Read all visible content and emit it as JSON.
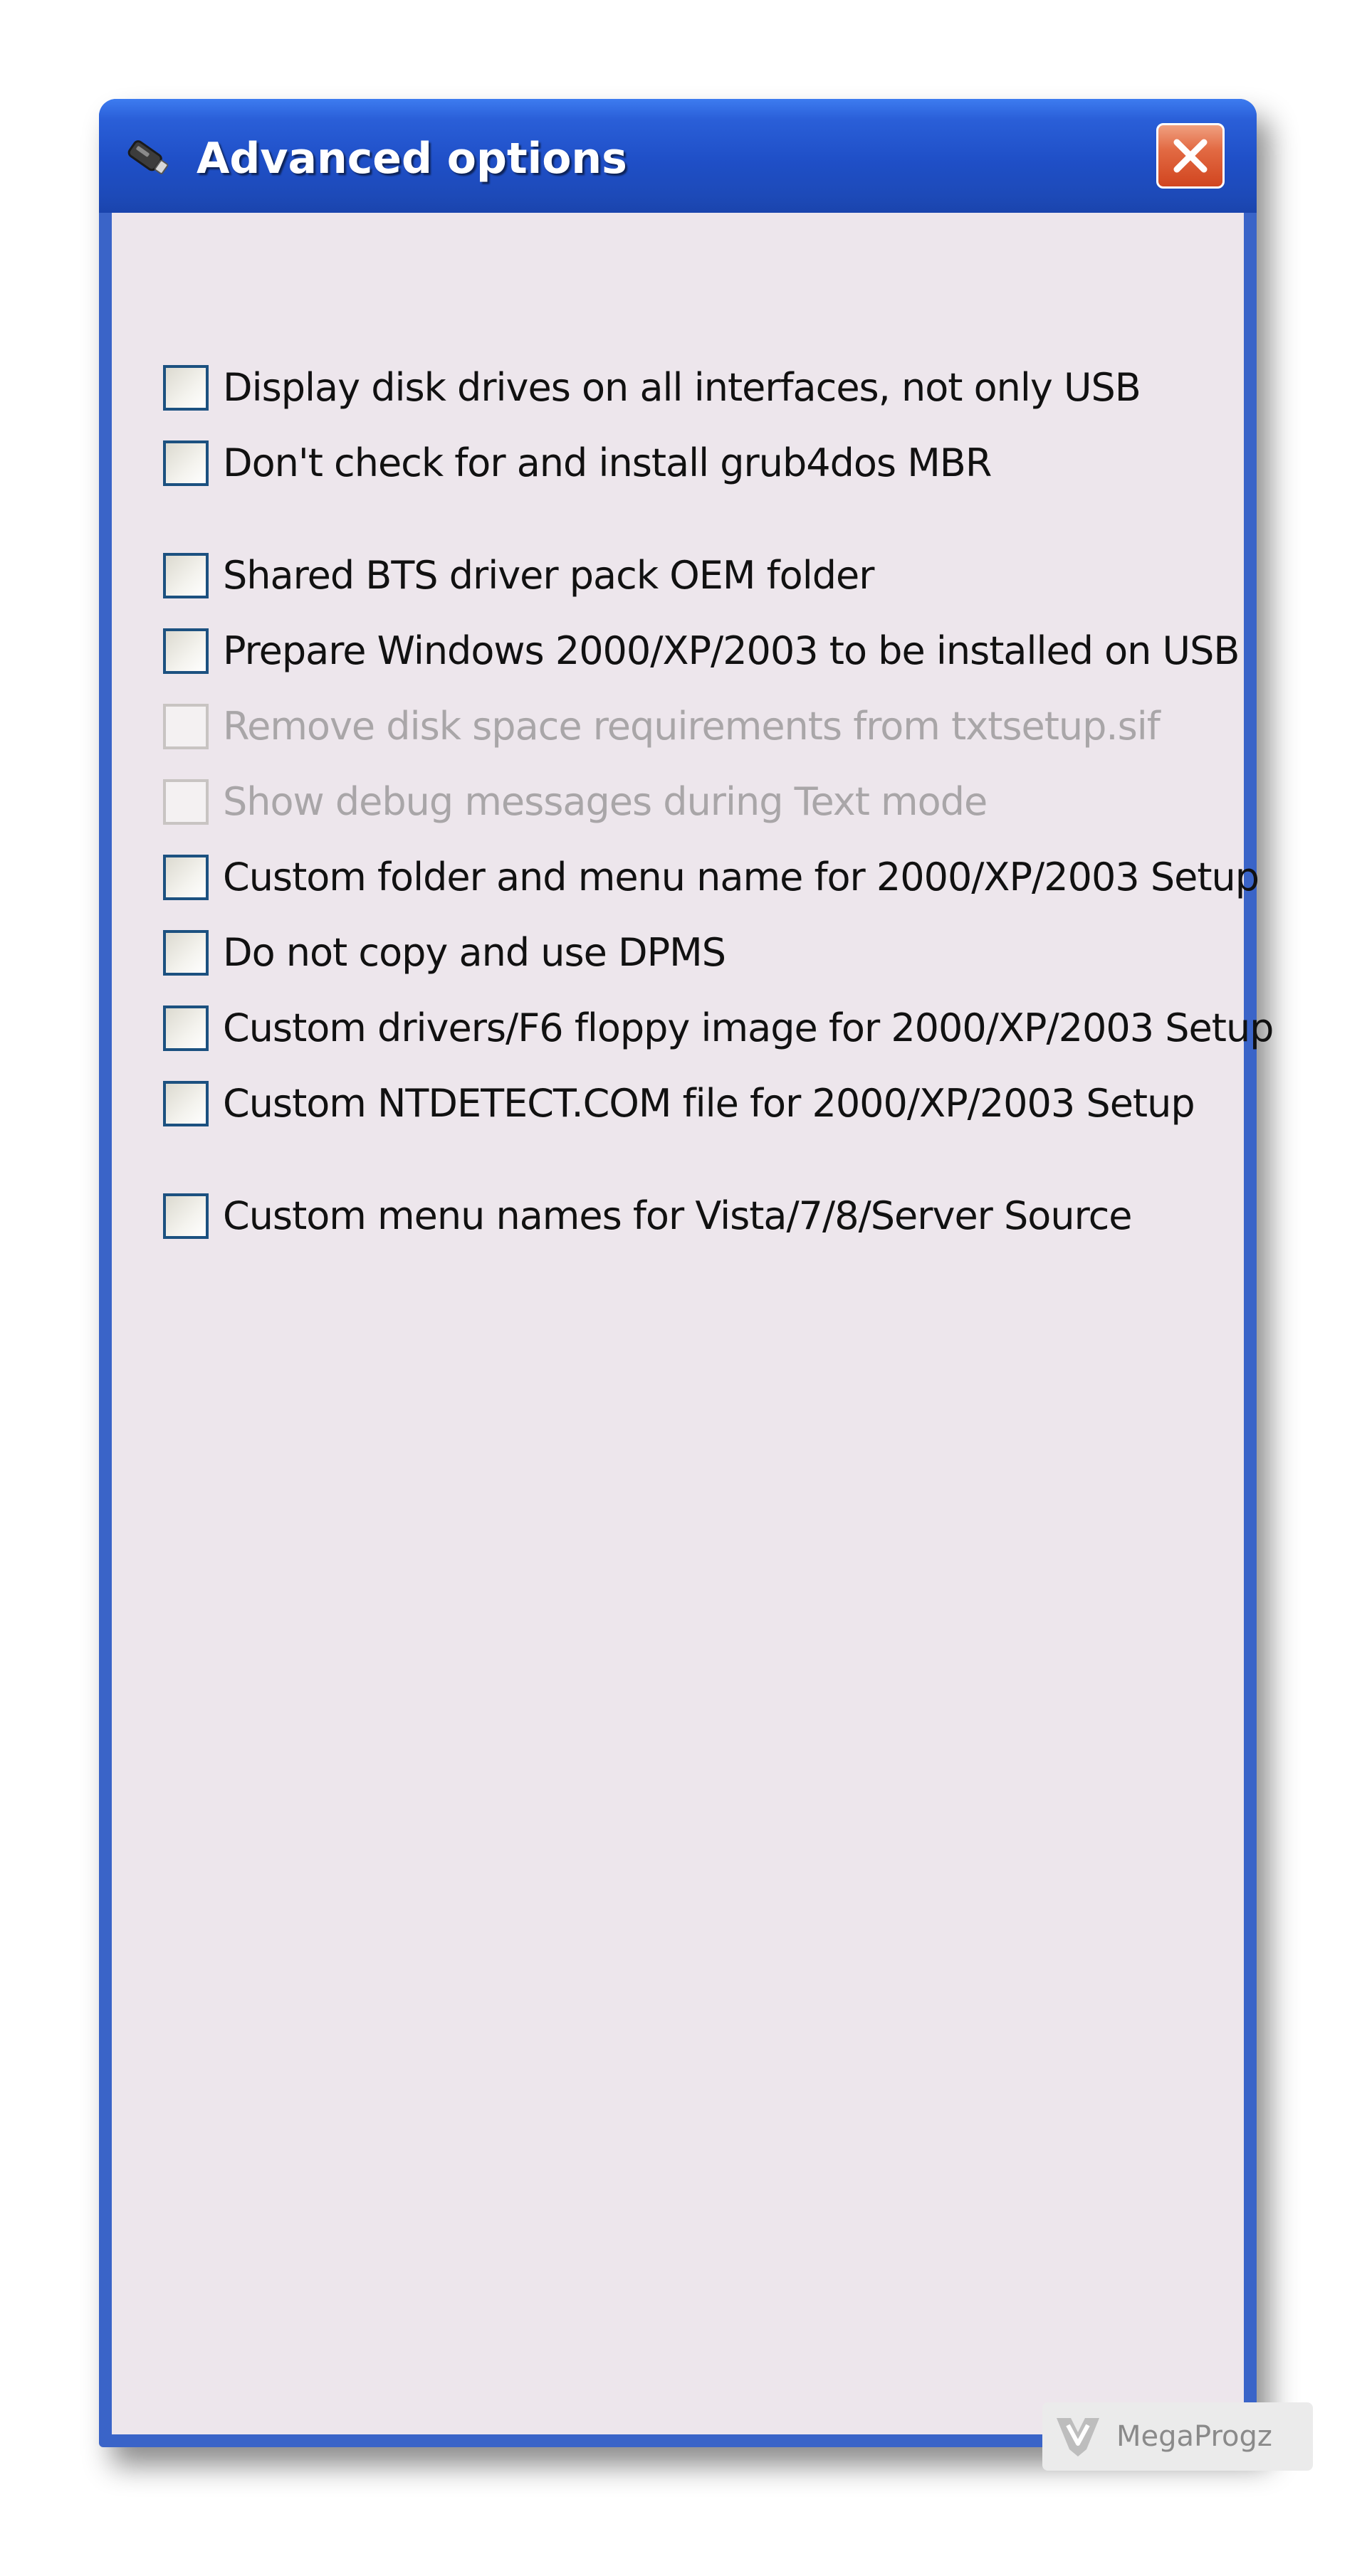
{
  "window": {
    "title": "Advanced options",
    "icon": "usb-drive-icon",
    "close_icon": "close-icon"
  },
  "options": [
    {
      "label": "Display disk drives on all interfaces, not only USB",
      "checked": false,
      "enabled": true
    },
    {
      "label": "Don't check for and install grub4dos MBR",
      "checked": false,
      "enabled": true
    },
    {
      "label": "Shared BTS driver pack OEM folder",
      "checked": false,
      "enabled": true
    },
    {
      "label": "Prepare Windows 2000/XP/2003 to be installed on USB",
      "checked": false,
      "enabled": true
    },
    {
      "label": "Remove disk space requirements from txtsetup.sif",
      "checked": false,
      "enabled": false
    },
    {
      "label": "Show debug messages during Text mode",
      "checked": false,
      "enabled": false
    },
    {
      "label": "Custom folder and menu name for 2000/XP/2003 Setup",
      "checked": false,
      "enabled": true
    },
    {
      "label": "Do not copy and use DPMS",
      "checked": false,
      "enabled": true
    },
    {
      "label": "Custom drivers/F6 floppy image for 2000/XP/2003 Setup",
      "checked": false,
      "enabled": true
    },
    {
      "label": "Custom NTDETECT.COM file for 2000/XP/2003 Setup",
      "checked": false,
      "enabled": true
    },
    {
      "label": "Custom menu names for Vista/7/8/Server Source",
      "checked": false,
      "enabled": true
    }
  ],
  "watermark": {
    "text": "MegaProgz",
    "icon": "megaprogz-logo-icon"
  },
  "colors": {
    "titlebar": "#1f4fc7",
    "client_background": "#ede6ec",
    "close_button": "#d1451f",
    "checkbox_border": "#1c5180",
    "disabled_text": "#a9a6a8"
  }
}
